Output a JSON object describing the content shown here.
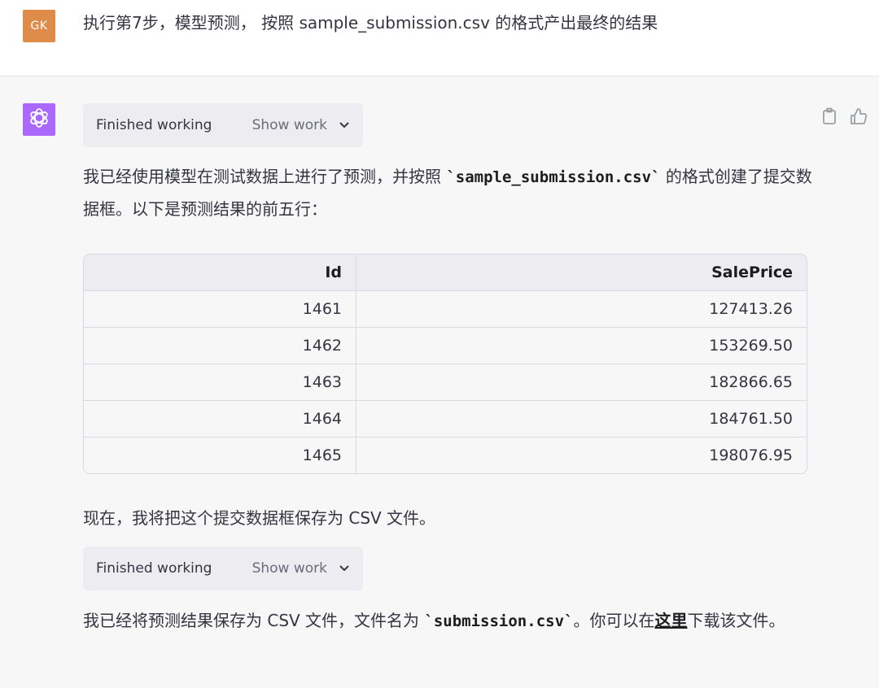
{
  "user": {
    "avatar_label": "GK",
    "message": "执行第7步，模型预测， 按照 sample_submission.csv 的格式产出最终的结果"
  },
  "assistant": {
    "work_pills": [
      {
        "label": "Finished working",
        "action": "Show work"
      },
      {
        "label": "Finished working",
        "action": "Show work"
      }
    ],
    "para1": {
      "before": "我已经使用模型在测试数据上进行了预测，并按照 ",
      "code": "`sample_submission.csv`",
      "after": " 的格式创建了提交数据框。以下是预测结果的前五行："
    },
    "table": {
      "headers": [
        "Id",
        "SalePrice"
      ],
      "rows": [
        [
          "1461",
          "127413.26"
        ],
        [
          "1462",
          "153269.50"
        ],
        [
          "1463",
          "182866.65"
        ],
        [
          "1464",
          "184761.50"
        ],
        [
          "1465",
          "198076.95"
        ]
      ]
    },
    "para2": "现在，我将把这个提交数据框保存为 CSV 文件。",
    "para3": {
      "before": "我已经将预测结果保存为 CSV 文件，文件名为 ",
      "code": "`submission.csv`",
      "middle": "。你可以在",
      "link": "这里",
      "after": "下载该文件。"
    }
  },
  "icons": {
    "copy": "clipboard-icon",
    "like": "thumbs-up-icon",
    "chevron": "chevron-down-icon",
    "ai_logo": "openai-logo-icon"
  },
  "colors": {
    "user_avatar": "#df8c4a",
    "ai_avatar": "#ab68ff",
    "pill_bg": "#ececf1",
    "assistant_bg": "#f7f7f8"
  }
}
